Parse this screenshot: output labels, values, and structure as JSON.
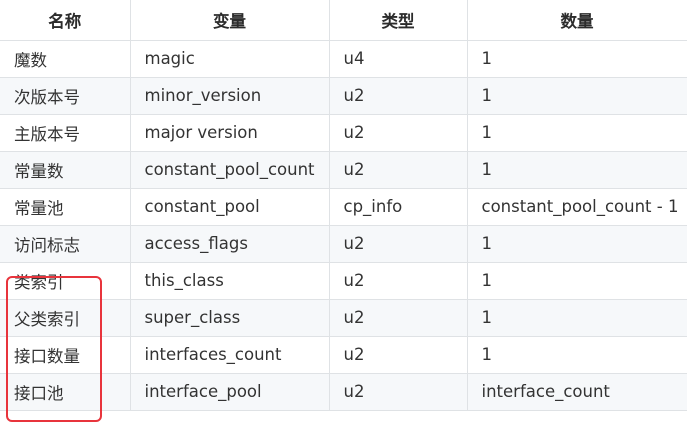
{
  "table": {
    "headers": [
      "名称",
      "变量",
      "类型",
      "数量"
    ],
    "rows": [
      [
        "魔数",
        "magic",
        "u4",
        "1"
      ],
      [
        "次版本号",
        "minor_version",
        "u2",
        "1"
      ],
      [
        "主版本号",
        "major version",
        "u2",
        "1"
      ],
      [
        "常量数",
        "constant_pool_count",
        "u2",
        "1"
      ],
      [
        "常量池",
        "constant_pool",
        "cp_info",
        "constant_pool_count - 1"
      ],
      [
        "访问标志",
        "access_flags",
        "u2",
        "1"
      ],
      [
        "类索引",
        "this_class",
        "u2",
        "1"
      ],
      [
        "父类索引",
        "super_class",
        "u2",
        "1"
      ],
      [
        "接口数量",
        "interfaces_count",
        "u2",
        "1"
      ],
      [
        "接口池",
        "interface_pool",
        "u2",
        "interface_count"
      ]
    ]
  },
  "colors": {
    "highlight_box": "#e8343c",
    "stripe": "#f6f8fa",
    "border": "#dfe2e5"
  }
}
